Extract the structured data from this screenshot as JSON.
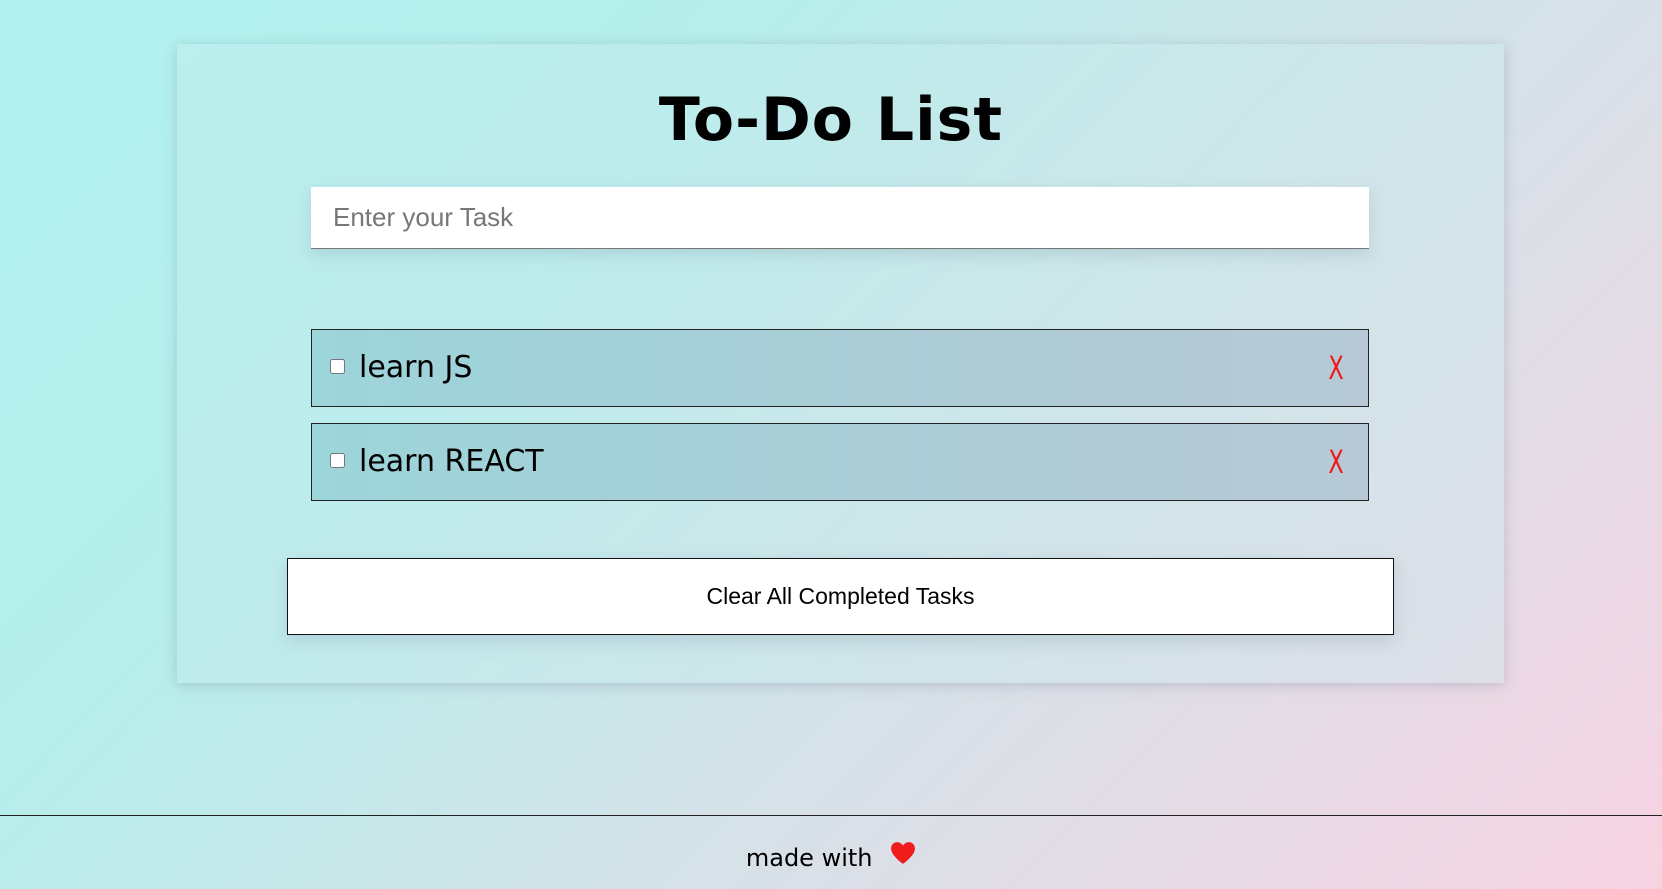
{
  "app": {
    "title": "To-Do List"
  },
  "input": {
    "placeholder": "Enter your Task",
    "value": ""
  },
  "tasks": [
    {
      "label": "learn JS",
      "completed": false,
      "delete_label": "X"
    },
    {
      "label": "learn REACT",
      "completed": false,
      "delete_label": "X"
    }
  ],
  "actions": {
    "clear_completed_label": "Clear All Completed Tasks"
  },
  "footer": {
    "text": "made with",
    "icon": "heart-icon",
    "icon_color": "#f01c1c"
  },
  "colors": {
    "delete": "#f01818"
  }
}
